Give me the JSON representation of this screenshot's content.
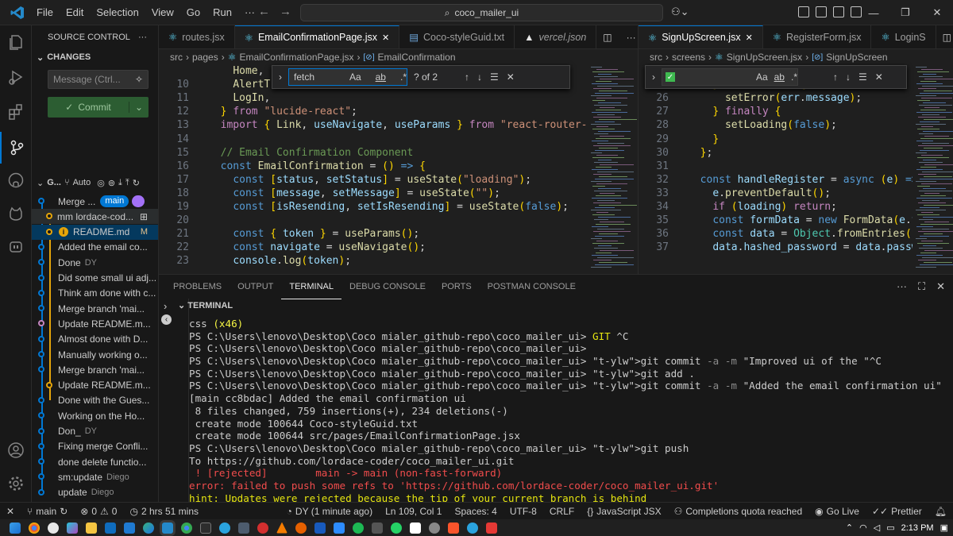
{
  "window": {
    "search_text": "coco_mailer_ui",
    "menu": [
      "File",
      "Edit",
      "Selection",
      "View",
      "Go",
      "Run",
      "···"
    ]
  },
  "colors": {
    "accent": "#0078d4",
    "commit_bg": "#2c5d32",
    "titlebar": "#1f1f1f"
  },
  "sidebar": {
    "title": "SOURCE CONTROL",
    "more": "···",
    "changes_label": "CHANGES",
    "message_placeholder": "Message (Ctrl...",
    "commit_label": "Commit",
    "graph_label": "G...",
    "graph_auto": "Auto",
    "graph_items": [
      {
        "text": "Merge ...",
        "badge": "main",
        "author": "",
        "color": "#0078d4"
      },
      {
        "text": "mm lordace-cod...",
        "badge": "",
        "author": "",
        "color": "#e5a50a"
      },
      {
        "text": "README.md",
        "badge": "",
        "author": "M",
        "color": "#e5a50a"
      },
      {
        "text": "Added the email co...",
        "badge": "",
        "author": "",
        "color": "#0078d4"
      },
      {
        "text": "Done",
        "badge": "",
        "author": "DY",
        "color": "#0078d4"
      },
      {
        "text": "Did some small ui adj...",
        "badge": "",
        "author": "",
        "color": "#0078d4"
      },
      {
        "text": "Think am done with c...",
        "badge": "",
        "author": "",
        "color": "#0078d4"
      },
      {
        "text": "Merge branch 'mai...",
        "badge": "",
        "author": "",
        "color": "#0078d4"
      },
      {
        "text": "Update README.m...",
        "badge": "",
        "author": "",
        "color": "#c586c0"
      },
      {
        "text": "Almost done with D...",
        "badge": "",
        "author": "",
        "color": "#0078d4"
      },
      {
        "text": "Manually working o...",
        "badge": "",
        "author": "",
        "color": "#0078d4"
      },
      {
        "text": "Merge branch 'mai...",
        "badge": "",
        "author": "",
        "color": "#0078d4"
      },
      {
        "text": "Update README.m...",
        "badge": "",
        "author": "",
        "color": "#e5a50a"
      },
      {
        "text": "Done with the Gues...",
        "badge": "",
        "author": "",
        "color": "#0078d4"
      },
      {
        "text": "Working on the Ho...",
        "badge": "",
        "author": "",
        "color": "#0078d4"
      },
      {
        "text": "Don_",
        "badge": "",
        "author": "DY",
        "color": "#0078d4"
      },
      {
        "text": "Fixing merge Confli...",
        "badge": "",
        "author": "",
        "color": "#0078d4"
      },
      {
        "text": "done delete functio...",
        "badge": "",
        "author": "",
        "color": "#0078d4"
      },
      {
        "text": "sm:update",
        "badge": "",
        "author": "Diego",
        "color": "#0078d4"
      },
      {
        "text": "update",
        "badge": "",
        "author": "Diego",
        "color": "#0078d4"
      }
    ]
  },
  "editor_left": {
    "tabs": [
      {
        "label": "routes.jsx",
        "icon": "react-icon",
        "active": false
      },
      {
        "label": "EmailConfirmationPage.jsx",
        "icon": "react-icon",
        "active": true
      },
      {
        "label": "Coco-styleGuid.txt",
        "icon": "text-file-icon",
        "active": false
      },
      {
        "label": "vercel.json",
        "icon": "vercel-icon",
        "active": false
      }
    ],
    "breadcrumb": [
      "src",
      "pages",
      "EmailConfirmationPage.jsx",
      "EmailConfirmation"
    ],
    "find": {
      "query": "fetch",
      "result": "? of 2"
    },
    "lines": [
      {
        "n": "",
        "t": "    Home,"
      },
      {
        "n": "10",
        "t": "    AlertTrian"
      },
      {
        "n": "11",
        "t": "    LogIn,"
      },
      {
        "n": "12",
        "t": "  } from \"lucide-react\";"
      },
      {
        "n": "13",
        "t": "  import { Link, useNavigate, useParams } from \"react-router-dom\";"
      },
      {
        "n": "14",
        "t": ""
      },
      {
        "n": "15",
        "t": "  // Email Confirmation Component"
      },
      {
        "n": "16",
        "t": "  const EmailConfirmation = () => {"
      },
      {
        "n": "17",
        "t": "    const [status, setStatus] = useState(\"loading\");"
      },
      {
        "n": "18",
        "t": "    const [message, setMessage] = useState(\"\");"
      },
      {
        "n": "19",
        "t": "    const [isResending, setIsResending] = useState(false);"
      },
      {
        "n": "20",
        "t": ""
      },
      {
        "n": "21",
        "t": "    const { token } = useParams();"
      },
      {
        "n": "22",
        "t": "    const navigate = useNavigate();"
      },
      {
        "n": "23",
        "t": "    console.log(token);"
      }
    ]
  },
  "editor_right": {
    "tabs": [
      {
        "label": "SignUpScreen.jsx",
        "icon": "react-icon",
        "active": true
      },
      {
        "label": "RegisterForm.jsx",
        "icon": "react-icon",
        "active": false
      },
      {
        "label": "LoginS",
        "icon": "react-icon",
        "active": false
      }
    ],
    "breadcrumb": [
      "src",
      "screens",
      "SignUpScreen.jsx",
      "SignUpScreen"
    ],
    "lines": [
      {
        "n": "24",
        "t": "      }"
      },
      {
        "n": "25",
        "t": "    } catch (err) {"
      },
      {
        "n": "26",
        "t": "      setError(err.message);"
      },
      {
        "n": "27",
        "t": "    } finally {"
      },
      {
        "n": "28",
        "t": "      setLoading(false);"
      },
      {
        "n": "29",
        "t": "    }"
      },
      {
        "n": "30",
        "t": "  };"
      },
      {
        "n": "31",
        "t": ""
      },
      {
        "n": "32",
        "t": "  const handleRegister = async (e) => {"
      },
      {
        "n": "33",
        "t": "    e.preventDefault();"
      },
      {
        "n": "34",
        "t": "    if (loading) return;"
      },
      {
        "n": "35",
        "t": "    const formData = new FormData(e.targe"
      },
      {
        "n": "36",
        "t": "    const data = Object.fromEntries(formDa"
      },
      {
        "n": "37",
        "t": "    data.hashed_password = data.password;"
      }
    ]
  },
  "panel": {
    "tabs": [
      "PROBLEMS",
      "OUTPUT",
      "TERMINAL",
      "DEBUG CONSOLE",
      "PORTS",
      "POSTMAN CONSOLE"
    ],
    "active_tab": "TERMINAL",
    "terminal_title": "TERMINAL",
    "lines": [
      "css (x46)",
      "PS C:\\Users\\lenovo\\Desktop\\Coco mialer_github-repo\\coco_mailer_ui> GIT ^C",
      "PS C:\\Users\\lenovo\\Desktop\\Coco mialer_github-repo\\coco_mailer_ui>",
      "PS C:\\Users\\lenovo\\Desktop\\Coco mialer_github-repo\\coco_mailer_ui> git commit -a -m \"Improved ui of the \"^C",
      "PS C:\\Users\\lenovo\\Desktop\\Coco mialer_github-repo\\coco_mailer_ui> git add .",
      "PS C:\\Users\\lenovo\\Desktop\\Coco mialer_github-repo\\coco_mailer_ui> git commit -a -m \"Added the email confirmation ui\"",
      "[main cc8bdac] Added the email confirmation ui",
      " 8 files changed, 759 insertions(+), 234 deletions(-)",
      " create mode 100644 Coco-styleGuid.txt",
      " create mode 100644 src/pages/EmailConfirmationPage.jsx",
      "PS C:\\Users\\lenovo\\Desktop\\Coco mialer_github-repo\\coco_mailer_ui> git push",
      "To https://github.com/lordace-coder/coco_mailer_ui.git",
      " ! [rejected]        main -> main (non-fast-forward)",
      "error: failed to push some refs to 'https://github.com/lordace-coder/coco_mailer_ui.git'",
      "hint: Updates were rejected because the tip of your current branch is behind"
    ]
  },
  "statusbar": {
    "branch": "main",
    "problems": "0 △ 0",
    "errors": "0",
    "warnings": "0",
    "time": "2 hrs 51 mins",
    "blame": "DY (1 minute ago)",
    "position": "Ln 109, Col 1",
    "spaces": "Spaces: 4",
    "encoding": "UTF-8",
    "eol": "CRLF",
    "language": "JavaScript JSX",
    "completions": "Completions quota reached",
    "golive": "Go Live",
    "prettier": "Prettier"
  },
  "taskbar": {
    "time": "2:13 PM"
  }
}
